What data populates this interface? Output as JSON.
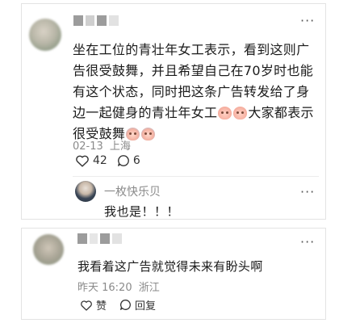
{
  "comment": {
    "text_part1": "坐在工位的青壮年女工表示，看到这则广告很受鼓舞，并且希望自己在70岁时也能有这个状态，同时把这条广告转发给了身边一起健身的青壮年女工",
    "text_part2": "大家都表示很受鼓舞",
    "date": "02-13",
    "location": "上海",
    "likes": "42",
    "replies": "6",
    "reply": {
      "author": "一枚快乐贝",
      "text": "我也是！！！"
    }
  },
  "comment2": {
    "text": "我看着这广告就觉得未来有盼头啊",
    "time": "昨天 16:20",
    "location": "浙江",
    "like_label": "赞",
    "reply_label": "回复"
  },
  "icons": {
    "more": "more-dots-icon",
    "like": "heart-outline-icon",
    "reply": "comment-bubble-icon",
    "emoji": "pig-crying-face-emoji"
  },
  "colors": {
    "meta_gray": "#8a8a8a",
    "border": "#e3e3e3"
  }
}
